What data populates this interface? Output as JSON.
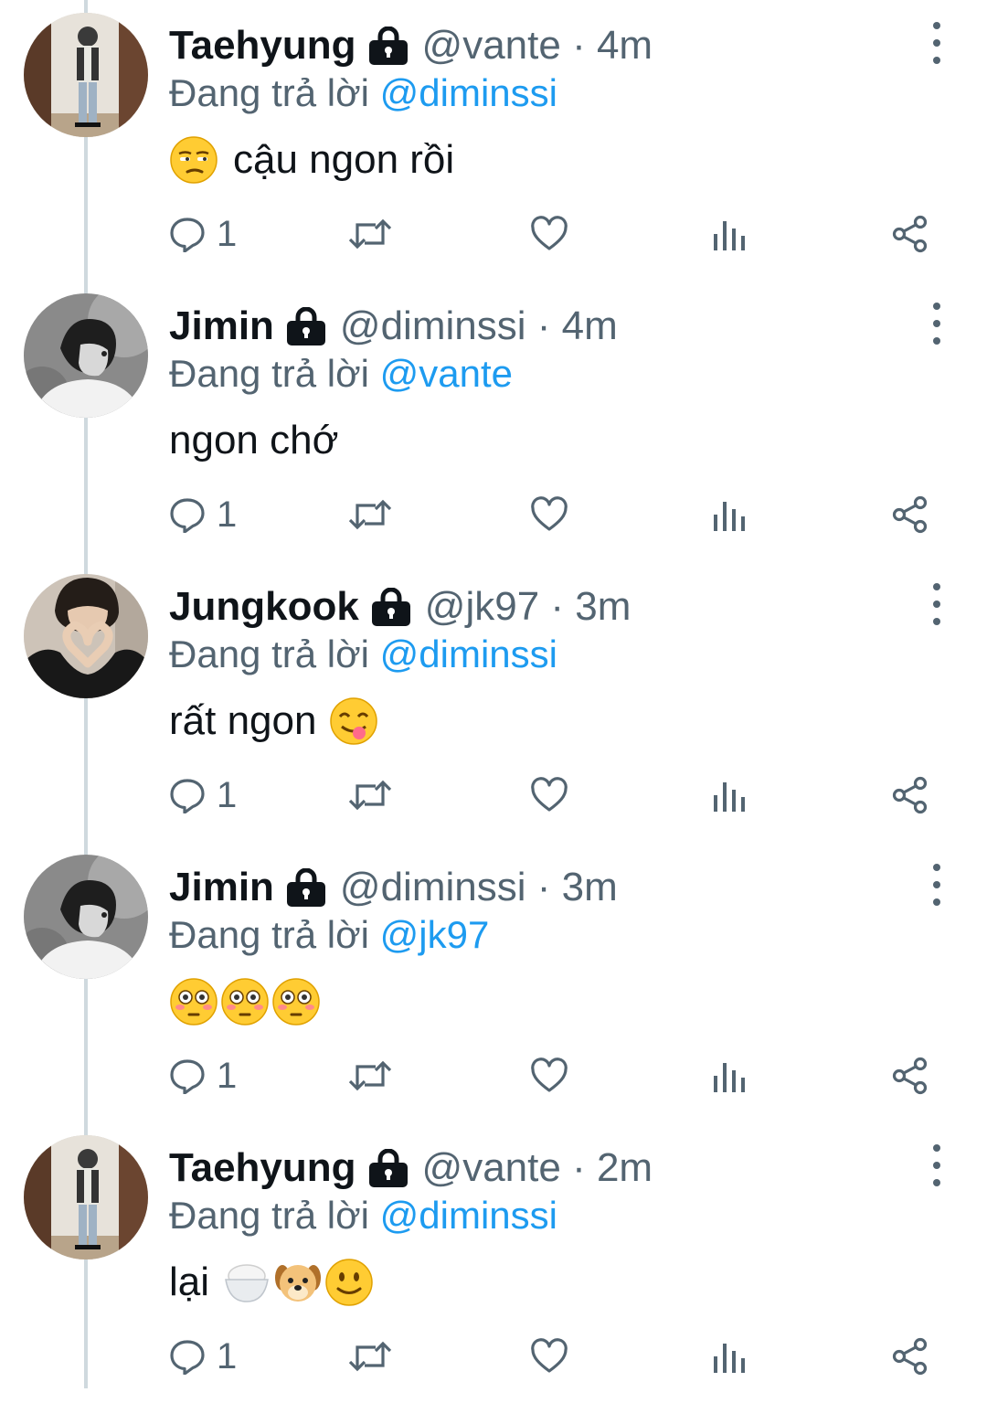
{
  "replying_prefix": "Đang trả lời",
  "colors": {
    "text": "#0f1419",
    "secondary": "#536471",
    "accent": "#1d9bf0",
    "line": "#cfd9de"
  },
  "tweets": [
    {
      "name": "Taehyung",
      "handle": "@vante",
      "time": "4m",
      "reply_to": "@diminssi",
      "text": "cậu ngon rồi",
      "emojis_before": [
        "unamused-face-emoji"
      ],
      "emojis_after": [],
      "reply_count": "1",
      "avatar": "person-standing-hallway-photo"
    },
    {
      "name": "Jimin",
      "handle": "@diminssi",
      "time": "4m",
      "reply_to": "@vante",
      "text": "ngon chớ",
      "emojis_before": [],
      "emojis_after": [],
      "reply_count": "1",
      "avatar": "grayscale-portrait-photo"
    },
    {
      "name": "Jungkook",
      "handle": "@jk97",
      "time": "3m",
      "reply_to": "@diminssi",
      "text": "rất ngon",
      "emojis_before": [],
      "emojis_after": [
        "yum-face-emoji"
      ],
      "reply_count": "1",
      "avatar": "heart-hands-photo"
    },
    {
      "name": "Jimin",
      "handle": "@diminssi",
      "time": "3m",
      "reply_to": "@jk97",
      "text": "",
      "emojis_before": [
        "flushed-face-emoji",
        "flushed-face-emoji",
        "flushed-face-emoji"
      ],
      "emojis_after": [],
      "reply_count": "1",
      "avatar": "grayscale-portrait-photo"
    },
    {
      "name": "Taehyung",
      "handle": "@vante",
      "time": "2m",
      "reply_to": "@diminssi",
      "text": "lại",
      "emojis_before": [],
      "emojis_after": [
        "rice-bowl-emoji",
        "dog-face-emoji",
        "slight-smile-emoji"
      ],
      "reply_count": "1",
      "avatar": "person-standing-hallway-photo"
    }
  ]
}
